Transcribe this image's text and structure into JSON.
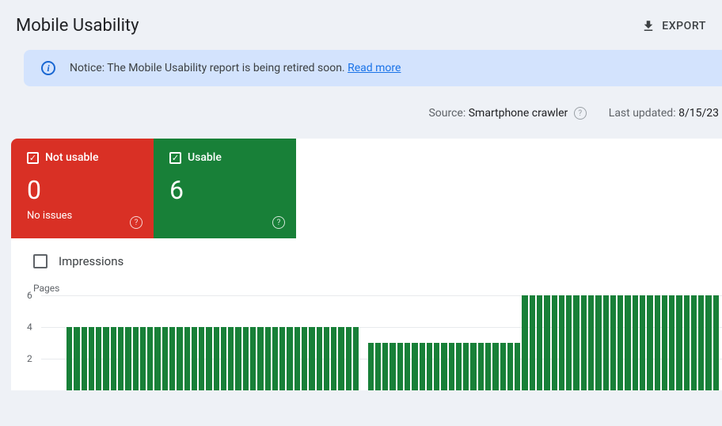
{
  "header": {
    "title": "Mobile Usability",
    "export": "EXPORT"
  },
  "notice": {
    "text": "Notice: The Mobile Usability report is being retired soon. ",
    "link": "Read more"
  },
  "meta": {
    "source_label": "Source:",
    "source_value": "Smartphone crawler",
    "updated_label": "Last updated:",
    "updated_value": "8/15/23"
  },
  "tiles": {
    "not_usable": {
      "label": "Not usable",
      "value": "0",
      "sub": "No issues"
    },
    "usable": {
      "label": "Usable",
      "value": "6"
    }
  },
  "impressions_label": "Impressions",
  "chart_data": {
    "type": "bar",
    "ylabel": "Pages",
    "ylim": [
      0,
      6
    ],
    "ticks": [
      2,
      4,
      6
    ],
    "values": [
      4,
      4,
      4,
      4,
      4,
      4,
      4,
      4,
      4,
      4,
      4,
      4,
      4,
      4,
      4,
      4,
      4,
      4,
      4,
      4,
      4,
      4,
      4,
      4,
      4,
      4,
      4,
      4,
      4,
      4,
      4,
      4,
      4,
      4,
      4,
      4,
      4,
      4,
      4,
      4,
      0,
      3,
      3,
      3,
      3,
      3,
      3,
      3,
      3,
      3,
      3,
      3,
      3,
      3,
      3,
      3,
      3,
      3,
      3,
      3,
      3,
      3,
      6,
      6,
      6,
      6,
      6,
      6,
      6,
      6,
      6,
      6,
      6,
      6,
      6,
      6,
      6,
      6,
      6,
      6,
      6,
      6,
      6,
      6,
      6,
      6,
      6,
      6,
      6
    ]
  }
}
